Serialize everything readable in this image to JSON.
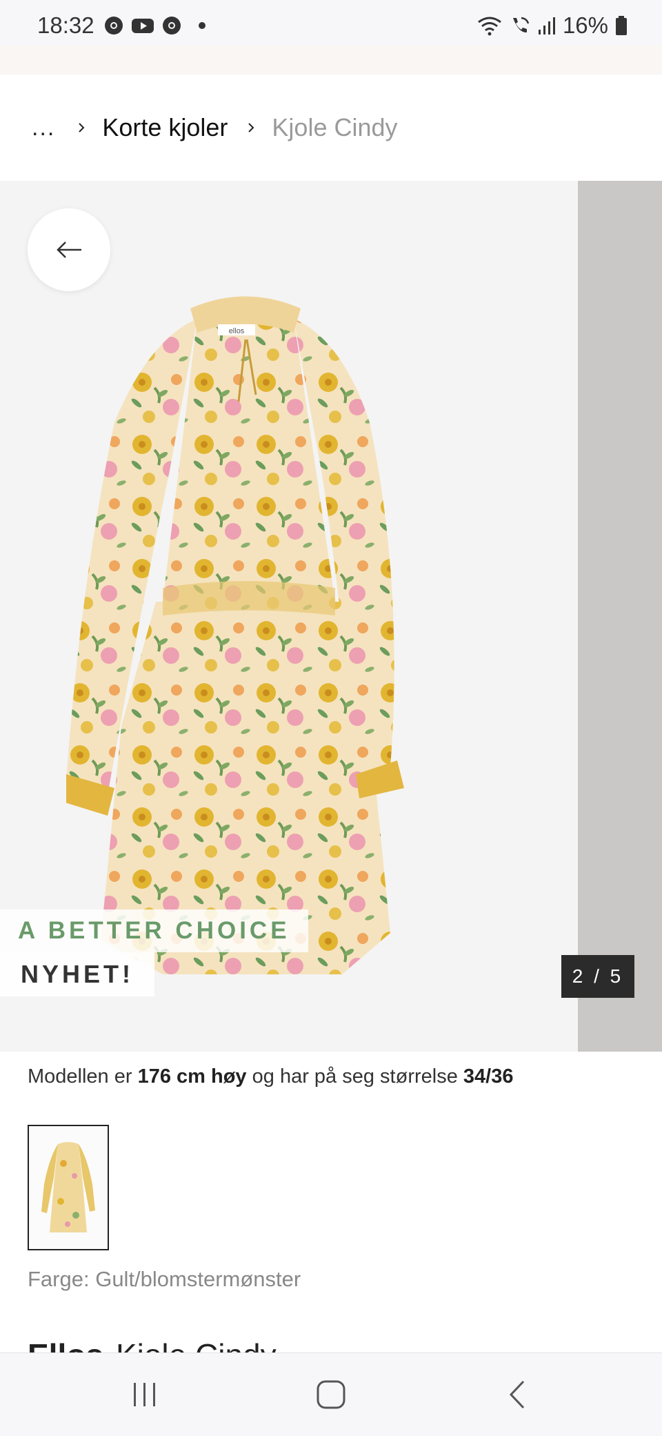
{
  "status_bar": {
    "time": "18:32",
    "apps": [
      "chrome-icon",
      "youtube-icon",
      "chrome-icon"
    ],
    "battery": "16%"
  },
  "breadcrumb": {
    "ellipsis": "...",
    "parent": "Korte kjoler",
    "current": "Kjole Cindy"
  },
  "gallery": {
    "badge_choice": "A BETTER CHOICE",
    "badge_new": "NYHET!",
    "counter": "2 / 5",
    "dress_label": "ellos"
  },
  "model_info": {
    "prefix": "Modellen er ",
    "height": "176 cm høy",
    "middle": " og har på seg størrelse ",
    "size": "34/36"
  },
  "color": {
    "label": "Farge: Gult/blomstermønster"
  },
  "product_title": {
    "brand": "Ellos",
    "name": "Kjole Cindy"
  },
  "colors": {
    "choice_green": "#6a9a6a",
    "counter_bg": "#2b2b2b",
    "gallery_bg": "#f4f4f4"
  }
}
